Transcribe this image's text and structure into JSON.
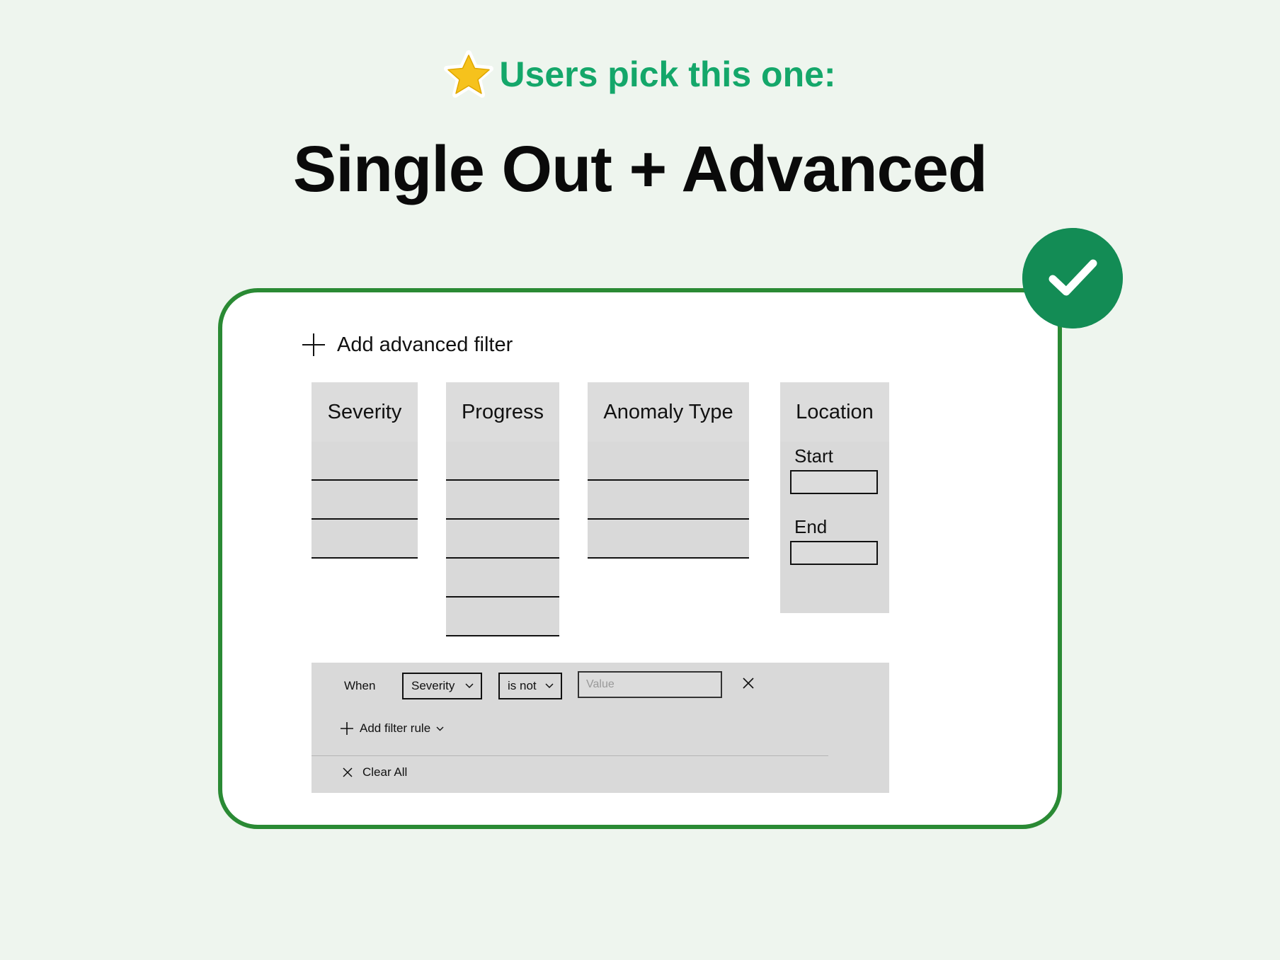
{
  "headline": {
    "text": "Users pick this one:",
    "icon": "star-icon",
    "color": "#14a76a"
  },
  "title": "Single Out + Advanced",
  "badge": {
    "icon": "checkmark-icon",
    "color": "#138c55"
  },
  "card": {
    "border_color": "#2a8a34"
  },
  "add_advanced_filter": {
    "label": "Add advanced filter",
    "icon": "plus-icon"
  },
  "columns": [
    {
      "title": "Severity",
      "rows": 3
    },
    {
      "title": "Progress",
      "rows": 5
    },
    {
      "title": "Anomaly Type",
      "rows": 3
    }
  ],
  "location": {
    "title": "Location",
    "start_label": "Start",
    "end_label": "End"
  },
  "filter_panel": {
    "when_label": "When",
    "field_select": "Severity",
    "operator_select": "is not",
    "value_placeholder": "Value",
    "remove_icon": "close-icon",
    "add_rule_label": "Add filter rule",
    "clear_all_label": "Clear All"
  }
}
